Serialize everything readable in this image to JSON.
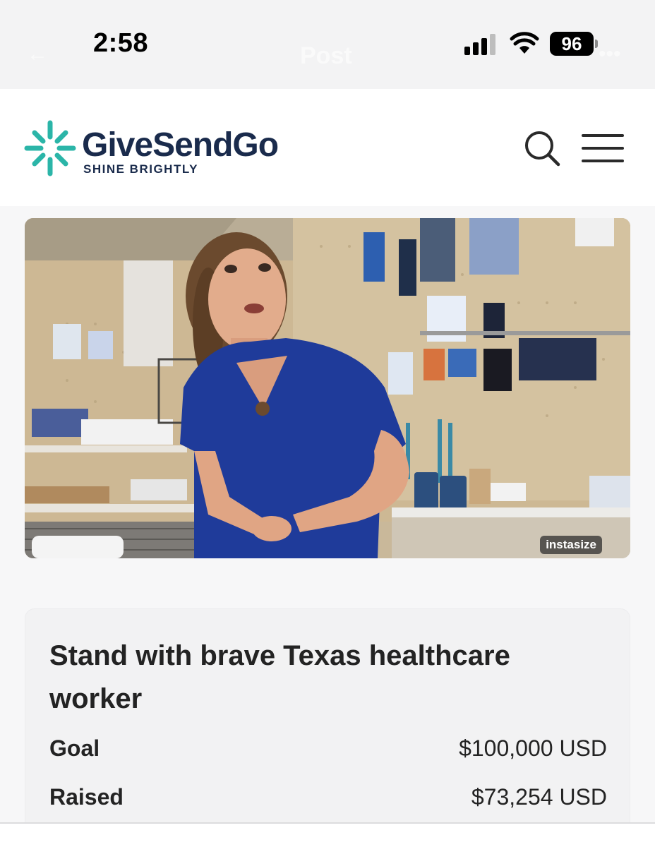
{
  "status_bar": {
    "time": "2:58",
    "battery": "96",
    "ghost_back": "←",
    "ghost_title": "Post",
    "ghost_more": "•••"
  },
  "header": {
    "brand_name": "GiveSendGo",
    "tagline": "SHINE BRIGHTLY",
    "icons": [
      "sparkle-logo-icon",
      "search-icon",
      "hamburger-menu-icon"
    ],
    "brand_colors": {
      "navy": "#1a2b4c",
      "teal": "#2bb5a8"
    }
  },
  "hero": {
    "watermark": "instasize"
  },
  "campaign": {
    "title": "Stand with brave Texas healthcare worker",
    "goal_label": "Goal",
    "goal_value": "$100,000 USD",
    "raised_label": "Raised",
    "raised_value": "$73,254 USD"
  }
}
